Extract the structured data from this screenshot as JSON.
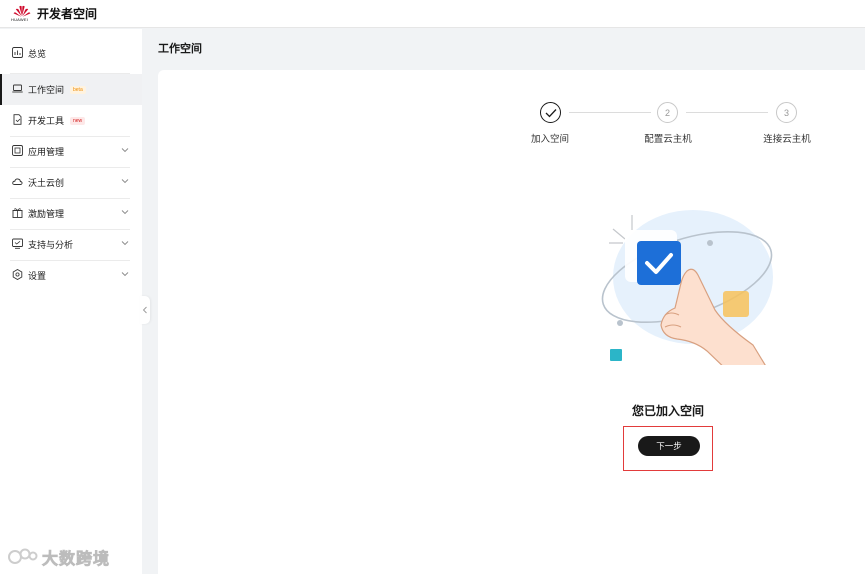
{
  "header": {
    "logo_text": "HUAWEI",
    "app_title": "开发者空间"
  },
  "sidebar": {
    "items": [
      {
        "label": "总览",
        "icon": "chart-icon"
      },
      {
        "label": "工作空间",
        "badge": "beta",
        "icon": "laptop-icon",
        "active": true
      },
      {
        "label": "开发工具",
        "badge": "new",
        "icon": "tool-file-icon"
      },
      {
        "label": "应用管理",
        "icon": "app-icon",
        "expandable": true
      },
      {
        "label": "沃土云创",
        "icon": "cloud-icon",
        "expandable": true
      },
      {
        "label": "激励管理",
        "icon": "gift-icon",
        "expandable": true
      },
      {
        "label": "支持与分析",
        "icon": "support-icon",
        "expandable": true
      },
      {
        "label": "设置",
        "icon": "gear-icon",
        "expandable": true
      }
    ]
  },
  "main": {
    "page_title": "工作空间",
    "steps": [
      {
        "number": "",
        "label": "加入空间",
        "status": "done"
      },
      {
        "number": "2",
        "label": "配置云主机",
        "status": "pending"
      },
      {
        "number": "3",
        "label": "连接云主机",
        "status": "pending"
      }
    ],
    "success_text": "您已加入空间",
    "next_button": "下一步"
  },
  "watermark": {
    "text": "大数跨境"
  },
  "colors": {
    "brand_red": "#cf0a2c",
    "accent_blue": "#1d6fd8",
    "dark": "#191919",
    "highlight_red": "#e23b3b",
    "beta_badge": "#f08c00",
    "new_badge": "#d42020"
  }
}
